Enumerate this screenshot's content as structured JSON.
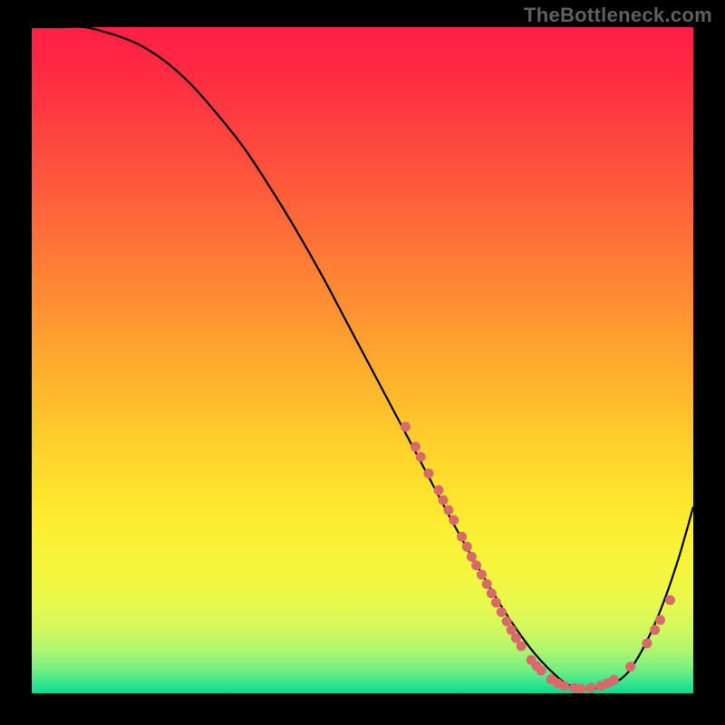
{
  "watermark": "TheBottleneck.com",
  "chart_data": {
    "type": "line",
    "title": "",
    "xlabel": "",
    "ylabel": "",
    "xlim": [
      0,
      100
    ],
    "ylim": [
      0,
      100
    ],
    "grid": false,
    "legend": false,
    "series": [
      {
        "name": "curve",
        "x": [
          0,
          4,
          8,
          12,
          16,
          20,
          24,
          28,
          32,
          36,
          40,
          44,
          48,
          52,
          56,
          60,
          64,
          68,
          72,
          76,
          80,
          82,
          84,
          86,
          88,
          90,
          92,
          94,
          96,
          98,
          100
        ],
        "y": [
          100,
          100,
          100,
          99,
          97.5,
          95,
          91.5,
          87,
          82,
          76,
          69.5,
          62.5,
          55,
          47.5,
          40,
          32.5,
          25,
          18,
          11.5,
          6,
          2,
          1,
          0.7,
          0.9,
          1.5,
          3,
          6,
          10,
          15,
          21,
          28
        ]
      }
    ],
    "markers": {
      "name": "dots",
      "color": "#d86a6a",
      "points": [
        {
          "x": 56.5,
          "y": 40
        },
        {
          "x": 58,
          "y": 37
        },
        {
          "x": 58.8,
          "y": 35.5
        },
        {
          "x": 60,
          "y": 33
        },
        {
          "x": 61.5,
          "y": 30.5
        },
        {
          "x": 62.2,
          "y": 29
        },
        {
          "x": 63,
          "y": 27.5
        },
        {
          "x": 63.8,
          "y": 26
        },
        {
          "x": 65,
          "y": 23.5
        },
        {
          "x": 65.8,
          "y": 22
        },
        {
          "x": 66.5,
          "y": 20.5
        },
        {
          "x": 67.2,
          "y": 19.2
        },
        {
          "x": 68,
          "y": 17.8
        },
        {
          "x": 68.8,
          "y": 16.4
        },
        {
          "x": 69.5,
          "y": 15
        },
        {
          "x": 70.2,
          "y": 13.6
        },
        {
          "x": 71,
          "y": 12.2
        },
        {
          "x": 71.8,
          "y": 10.8
        },
        {
          "x": 72.5,
          "y": 9.5
        },
        {
          "x": 73.2,
          "y": 8.3
        },
        {
          "x": 74,
          "y": 7.1
        },
        {
          "x": 75.5,
          "y": 5
        },
        {
          "x": 76.3,
          "y": 4.1
        },
        {
          "x": 77,
          "y": 3.4
        },
        {
          "x": 78.5,
          "y": 2.1
        },
        {
          "x": 79.5,
          "y": 1.5
        },
        {
          "x": 80.5,
          "y": 1.1
        },
        {
          "x": 82,
          "y": 0.8
        },
        {
          "x": 83,
          "y": 0.7
        },
        {
          "x": 84.5,
          "y": 0.8
        },
        {
          "x": 86,
          "y": 1.1
        },
        {
          "x": 87,
          "y": 1.5
        },
        {
          "x": 88,
          "y": 2
        },
        {
          "x": 90.5,
          "y": 4
        },
        {
          "x": 93,
          "y": 7.5
        },
        {
          "x": 94.2,
          "y": 9.5
        },
        {
          "x": 95,
          "y": 11
        },
        {
          "x": 96.5,
          "y": 14
        }
      ]
    },
    "gradient_stops": [
      {
        "offset": 0.0,
        "color": "#ff1e44"
      },
      {
        "offset": 0.07,
        "color": "#ff2b42"
      },
      {
        "offset": 0.14,
        "color": "#ff3e40"
      },
      {
        "offset": 0.21,
        "color": "#ff513d"
      },
      {
        "offset": 0.28,
        "color": "#ff663a"
      },
      {
        "offset": 0.35,
        "color": "#ff7b36"
      },
      {
        "offset": 0.42,
        "color": "#ff9032"
      },
      {
        "offset": 0.49,
        "color": "#ffa62e"
      },
      {
        "offset": 0.56,
        "color": "#ffbc2c"
      },
      {
        "offset": 0.63,
        "color": "#ffd12b"
      },
      {
        "offset": 0.7,
        "color": "#ffe32d"
      },
      {
        "offset": 0.76,
        "color": "#fcef33"
      },
      {
        "offset": 0.82,
        "color": "#f4f63e"
      },
      {
        "offset": 0.87,
        "color": "#e6f94e"
      },
      {
        "offset": 0.91,
        "color": "#ccf960"
      },
      {
        "offset": 0.94,
        "color": "#a6f572"
      },
      {
        "offset": 0.965,
        "color": "#72ef82"
      },
      {
        "offset": 0.985,
        "color": "#34e58e"
      },
      {
        "offset": 1.0,
        "color": "#07dd95"
      }
    ]
  }
}
